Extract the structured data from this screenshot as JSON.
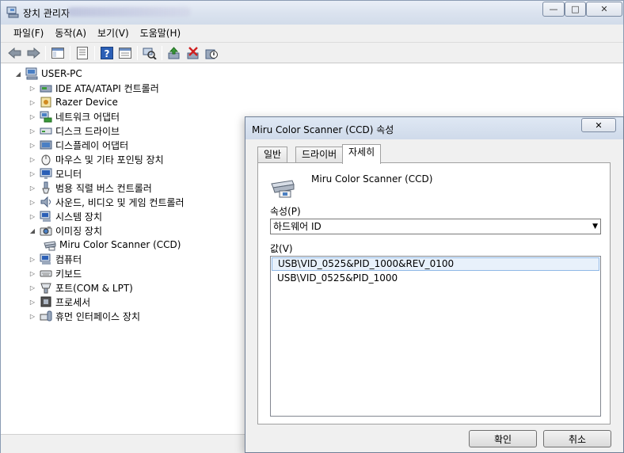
{
  "window": {
    "title": "장치 관리자",
    "controls": {
      "minimize": "—",
      "maximize": "□",
      "close": "✕"
    }
  },
  "menu": [
    {
      "label": "파일(F)"
    },
    {
      "label": "동작(A)"
    },
    {
      "label": "보기(V)"
    },
    {
      "label": "도움말(H)"
    }
  ],
  "tree": {
    "root": "USER-PC",
    "nodes": [
      {
        "label": "IDE ATA/ATAPI 컨트롤러",
        "icon": "ide-controller-icon"
      },
      {
        "label": "Razer Device",
        "icon": "razer-device-icon"
      },
      {
        "label": "네트워크 어댑터",
        "icon": "network-adapter-icon"
      },
      {
        "label": "디스크 드라이브",
        "icon": "disk-drive-icon"
      },
      {
        "label": "디스플레이 어댑터",
        "icon": "display-adapter-icon"
      },
      {
        "label": "마우스 및 기타 포인팅 장치",
        "icon": "mouse-icon"
      },
      {
        "label": "모니터",
        "icon": "monitor-icon"
      },
      {
        "label": "범용 직렬 버스 컨트롤러",
        "icon": "usb-controller-icon"
      },
      {
        "label": "사운드, 비디오 및 게임 컨트롤러",
        "icon": "sound-icon"
      },
      {
        "label": "시스템 장치",
        "icon": "system-device-icon"
      },
      {
        "label": "이미징 장치",
        "icon": "imaging-device-icon",
        "expanded": true
      },
      {
        "label": "Miru Color Scanner (CCD)",
        "icon": "scanner-icon",
        "child": true
      },
      {
        "label": "컴퓨터",
        "icon": "computer-icon"
      },
      {
        "label": "키보드",
        "icon": "keyboard-icon"
      },
      {
        "label": "포트(COM & LPT)",
        "icon": "port-icon"
      },
      {
        "label": "프로세서",
        "icon": "processor-icon"
      },
      {
        "label": "휴먼 인터페이스 장치",
        "icon": "hid-icon"
      }
    ]
  },
  "dialog": {
    "title": "Miru Color Scanner (CCD) 속성",
    "close": "✕",
    "tabs": [
      {
        "label": "일반"
      },
      {
        "label": "드라이버"
      },
      {
        "label": "자세히",
        "active": true
      }
    ],
    "device_name": "Miru Color Scanner (CCD)",
    "property_label": "속성(P)",
    "property_selected": "하드웨어 ID",
    "value_label": "값(V)",
    "values": [
      {
        "text": "USB\\VID_0525&PID_1000&REV_0100",
        "selected": true
      },
      {
        "text": "USB\\VID_0525&PID_1000"
      }
    ],
    "ok": "확인",
    "cancel": "취소"
  },
  "colors": {
    "titlebar": "#dbe3ef",
    "selection": "#e8f1fb",
    "selection_border": "#8fb8e6"
  }
}
